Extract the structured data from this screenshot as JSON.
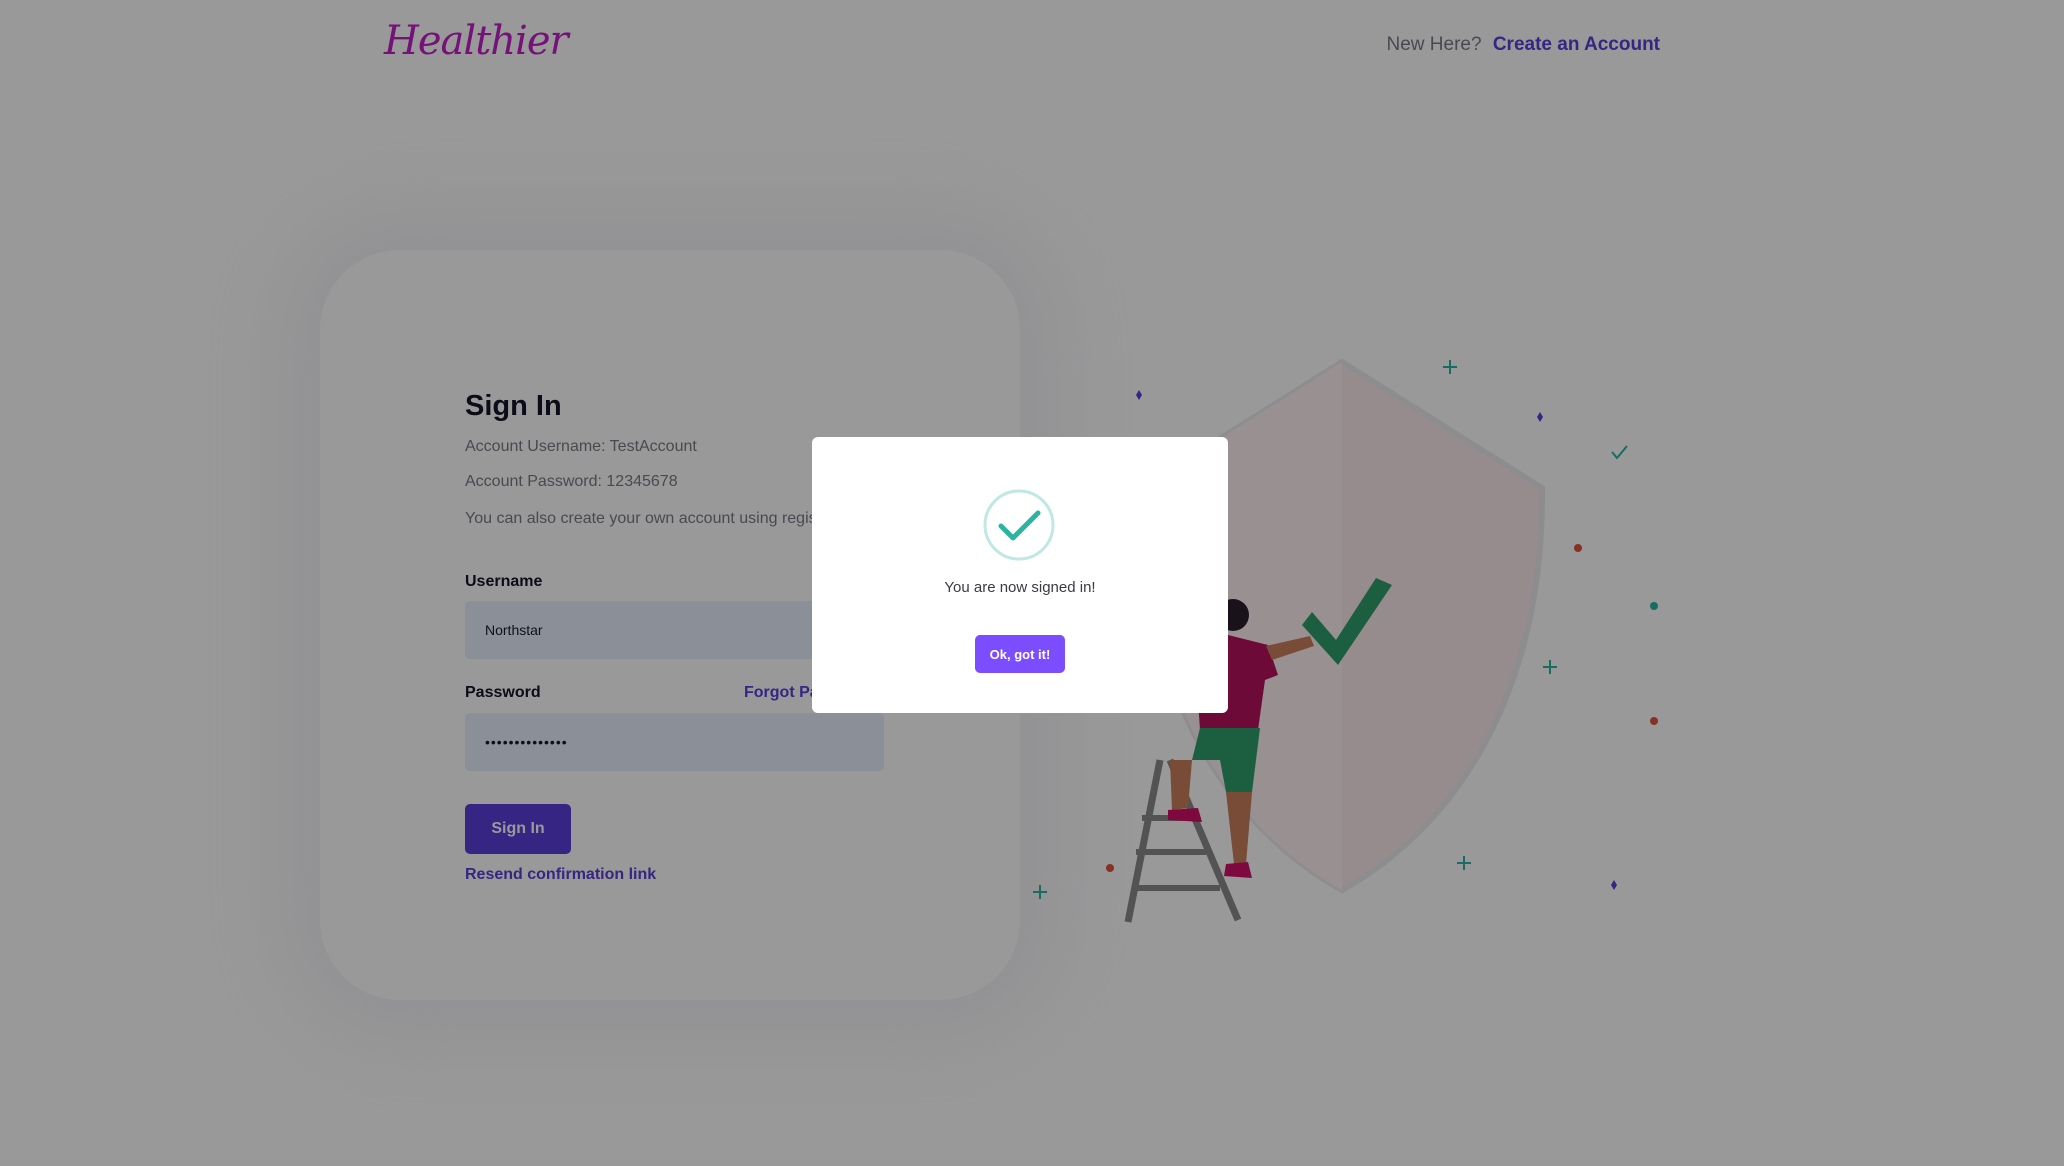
{
  "header": {
    "logo_text": "Healthier",
    "new_here_text": "New Here?",
    "create_account_link": "Create an Account"
  },
  "signin": {
    "title": "Sign In",
    "account_username_info": "Account Username: TestAccount",
    "account_password_info": "Account Password: 12345678",
    "create_info": "You can also create your own account using registration.",
    "username_label": "Username",
    "username_value": "Northstar",
    "password_label": "Password",
    "forgot_password_link": "Forgot Password?",
    "password_value": "••••••••••••••",
    "signin_button": "Sign In",
    "resend_link": "Resend confirmation link"
  },
  "modal": {
    "icon": "check-circle-icon",
    "message": "You are now signed in!",
    "ok_button": "Ok, got it!"
  },
  "colors": {
    "brand": "#5b3fd9",
    "logo": "#c21fc9",
    "modal_button": "#7c4dff",
    "success": "#2bb5a0"
  }
}
